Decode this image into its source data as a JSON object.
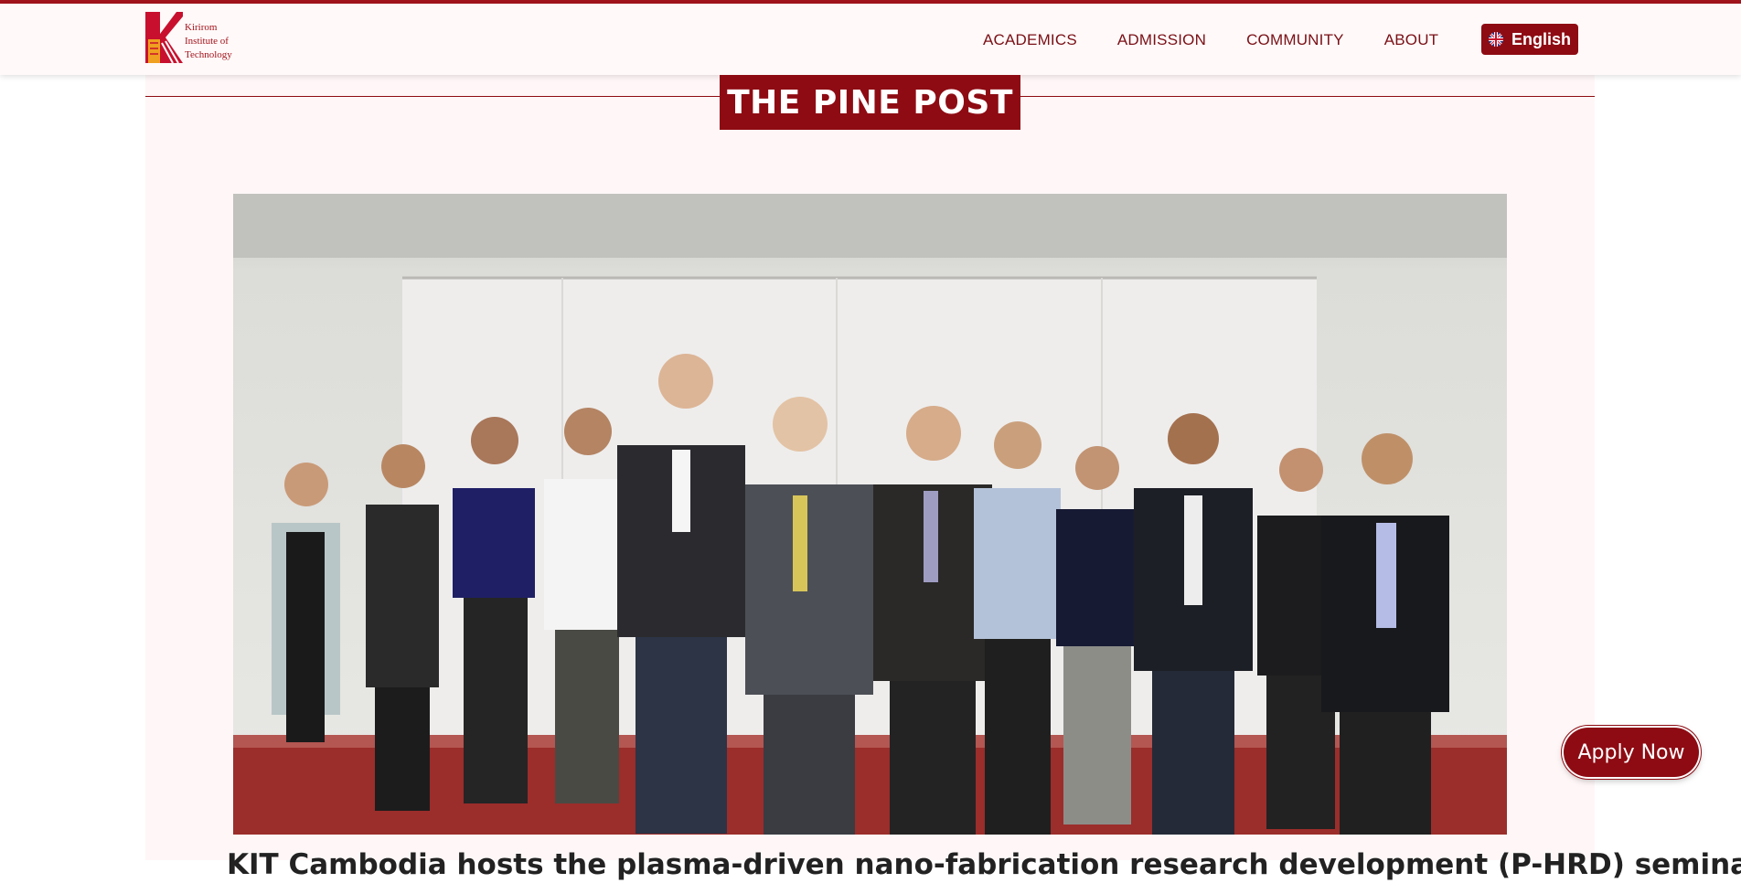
{
  "header": {
    "logo": {
      "lines": [
        "Kirirom",
        "Institute of",
        "Technology"
      ]
    },
    "nav": [
      "ACADEMICS",
      "ADMISSION",
      "COMMUNITY",
      "ABOUT"
    ],
    "language": {
      "label": "English",
      "icon": "uk-flag-icon"
    }
  },
  "section": {
    "title": "THE PINE POST"
  },
  "article": {
    "image": "group-photo",
    "title": "KIT Cambodia hosts the plasma-driven nano-fabrication research development (P-HRD) seminar"
  },
  "apply_button": {
    "label": "Apply Now"
  },
  "colors": {
    "brand": "#8e0b13",
    "nav_text": "#7a1016",
    "page_bg": "#fff7f7"
  }
}
